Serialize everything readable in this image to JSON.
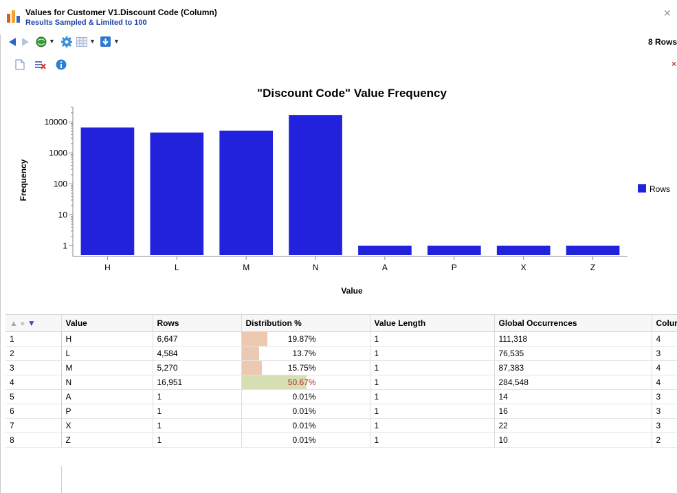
{
  "window": {
    "title": "Values for Customer V1.Discount Code (Column)",
    "subtitle": "Results Sampled & Limited to 100",
    "row_count": "8 Rows"
  },
  "toolbar": {
    "icons": [
      "back-arrow-icon",
      "forward-arrow-icon",
      "globe-icon",
      "gear-icon",
      "grid-icon",
      "export-icon"
    ]
  },
  "chart_data": {
    "type": "bar",
    "title": "\"Discount Code\" Value Frequency",
    "xlabel": "Value",
    "ylabel": "Frequency",
    "yscale": "log",
    "ylim": [
      0.5,
      30000
    ],
    "yticks": [
      "1",
      "10",
      "100",
      "1000",
      "10000"
    ],
    "categories": [
      "H",
      "L",
      "M",
      "N",
      "A",
      "P",
      "X",
      "Z"
    ],
    "series": [
      {
        "name": "Rows",
        "values": [
          6647,
          4584,
          5270,
          16951,
          1,
          1,
          1,
          1
        ],
        "color": "#2222dd"
      }
    ],
    "legend": "right",
    "grid": false
  },
  "table": {
    "columns": [
      "Value",
      "Rows",
      "Distribution %",
      "Value Length",
      "Global Occurrences",
      "Colur"
    ],
    "rows": [
      {
        "n": "1",
        "value": "H",
        "rows": "6,647",
        "dist": "19.87%",
        "frac": 0.1987,
        "len": "1",
        "global": "111,318",
        "col": "4"
      },
      {
        "n": "2",
        "value": "L",
        "rows": "4,584",
        "dist": "13.7%",
        "frac": 0.137,
        "len": "1",
        "global": "76,535",
        "col": "3"
      },
      {
        "n": "3",
        "value": "M",
        "rows": "5,270",
        "dist": "15.75%",
        "frac": 0.1575,
        "len": "1",
        "global": "87,383",
        "col": "4"
      },
      {
        "n": "4",
        "value": "N",
        "rows": "16,951",
        "dist": "50.67%",
        "frac": 0.5067,
        "len": "1",
        "global": "284,548",
        "col": "4"
      },
      {
        "n": "5",
        "value": "A",
        "rows": "1",
        "dist": "0.01%",
        "frac": 0.0001,
        "len": "1",
        "global": "14",
        "col": "3"
      },
      {
        "n": "6",
        "value": "P",
        "rows": "1",
        "dist": "0.01%",
        "frac": 0.0001,
        "len": "1",
        "global": "16",
        "col": "3"
      },
      {
        "n": "7",
        "value": "X",
        "rows": "1",
        "dist": "0.01%",
        "frac": 0.0001,
        "len": "1",
        "global": "22",
        "col": "3"
      },
      {
        "n": "8",
        "value": "Z",
        "rows": "1",
        "dist": "0.01%",
        "frac": 0.0001,
        "len": "1",
        "global": "10",
        "col": "2"
      }
    ],
    "colors": {
      "bar_normal": "#ecc9b0",
      "bar_high": "#d6dfb3",
      "highlight_text": "#b22222"
    }
  }
}
